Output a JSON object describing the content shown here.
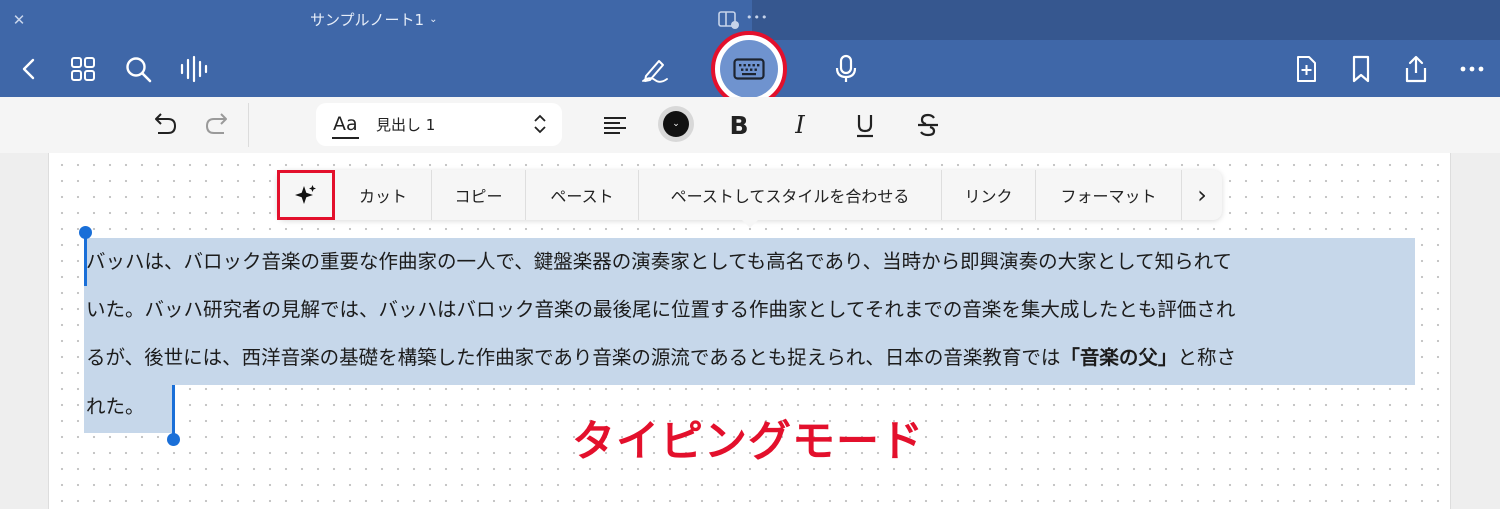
{
  "app": {
    "doc_title": "サンプルノート1",
    "title_chevron": "⌄",
    "more_dots_top": "•••",
    "accent_color": "#3f67a8",
    "highlight_color": "#e3102c",
    "selection_color": "#c6d7ea"
  },
  "toolbar": {
    "left_icons": [
      "back-chevron-icon",
      "grid-icon",
      "search-icon",
      "waveform-icon"
    ],
    "center_icons": [
      "pen-icon",
      "keyboard-icon",
      "microphone-icon"
    ],
    "right_icons": [
      "add-page-icon",
      "bookmark-icon",
      "share-icon",
      "more-icon"
    ]
  },
  "formatbar": {
    "style_prefix": "Aa",
    "style_value": "見出し 1",
    "bold": "B",
    "italic": "I",
    "color_chevron": "⌄"
  },
  "context_menu": {
    "items": [
      "カット",
      "コピー",
      "ペースト",
      "ペーストしてスタイルを合わせる",
      "リンク",
      "フォーマット"
    ],
    "ai_icon": "sparkle-icon",
    "more": "›"
  },
  "document": {
    "lines": [
      "バッハは、バロック音楽の重要な作曲家の一人で、鍵盤楽器の演奏家としても高名であり、当時から即興演奏の大家として知られて",
      "いた。バッハ研究者の見解では、バッハはバロック音楽の最後尾に位置する作曲家としてそれまでの音楽を集大成したとも評価され",
      "るが、後世には、西洋音楽の基礎を構築した作曲家であり音楽の源流であるとも捉えられ、日本の音楽教育では",
      "れた。"
    ],
    "line3_bold": "「音楽の父」",
    "line3_tail": "と称さ"
  },
  "annotation": {
    "mode_label": "タイピングモード"
  }
}
